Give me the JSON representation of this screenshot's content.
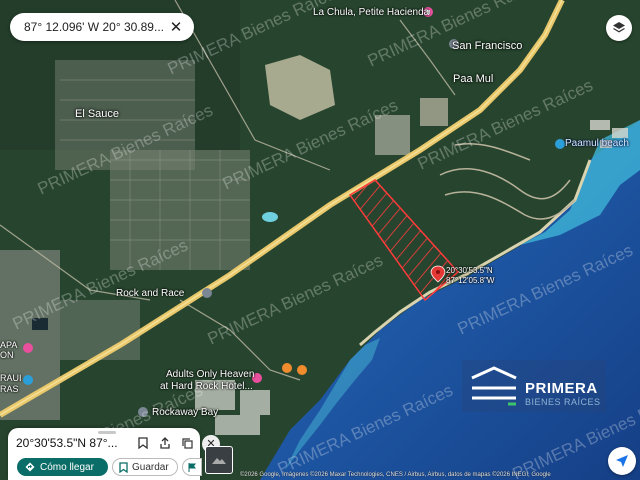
{
  "search_bar": {
    "coordinates": "87° 12.096' W 20° 30.89...",
    "close_glyph": "✕"
  },
  "map": {
    "places": [
      {
        "name": "La Chula, Petite Hacienda"
      },
      {
        "name": "San Francisco"
      },
      {
        "name": "Paa Mul"
      },
      {
        "name": "El Sauce"
      },
      {
        "name": "Paamul beach"
      },
      {
        "name": "Rock and Race"
      },
      {
        "name": "Adults Only Heaven"
      },
      {
        "name": "at Hard Rock Hotel..."
      },
      {
        "name": "Rockaway Bay"
      }
    ],
    "edge_labels": [
      "APA",
      "ON",
      "RAUI",
      "RAS"
    ],
    "pin": {
      "line1": "20°30'53.5\"N",
      "line2": "87°12'05.8\"W"
    },
    "watermark_text": "PRIMERA Bienes Raíces",
    "colors": {
      "parcel": "#ff3b3b",
      "sea": "#1f5aa8",
      "road": "#e8c86a",
      "accent": "#0b6d67"
    }
  },
  "logo": {
    "name": "PRIMERA",
    "tagline": "BIENES RAÍCES"
  },
  "sheet": {
    "title": "20°30'53.5\"N 87°...",
    "directions_label": "Cómo llegar",
    "save_label": "Guardar",
    "icons": [
      "bookmark-icon",
      "share-icon",
      "copy-icon"
    ],
    "close_glyph": "✕"
  },
  "attribution": "©2026 Google, Imágenes ©2026 Maxar Technologies, CNES / Airbus, Airbus, datos de mapas ©2026 INEGI, Google"
}
